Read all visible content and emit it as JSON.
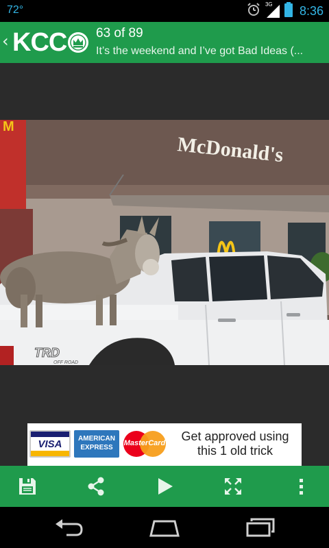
{
  "status_bar": {
    "temperature": "72°",
    "network": "3G",
    "time": "8:36",
    "icons": [
      "alarm-icon",
      "signal-icon",
      "battery-icon"
    ]
  },
  "header": {
    "logo_text": "KCC",
    "counter": "63 of 89",
    "subtitle": "It’s the weekend and I’ve got Bad Ideas (..."
  },
  "photo": {
    "sign_text": "McDonald's",
    "truck_badge": "TRD",
    "truck_badge_sub": "OFF ROAD"
  },
  "ad": {
    "cards": [
      "VISA",
      "AMERICAN EXPRESS",
      "MasterCard"
    ],
    "text": "Get approved using this 1 old trick"
  },
  "toolbar": {
    "buttons": [
      "save-icon",
      "share-icon",
      "play-icon",
      "fullscreen-icon",
      "overflow-menu-icon"
    ]
  },
  "nav": {
    "buttons": [
      "back-icon",
      "home-icon",
      "recent-apps-icon"
    ]
  },
  "colors": {
    "brand_green": "#1f9b4c",
    "status_blue": "#33b5e5",
    "background": "#2b2b2b"
  }
}
